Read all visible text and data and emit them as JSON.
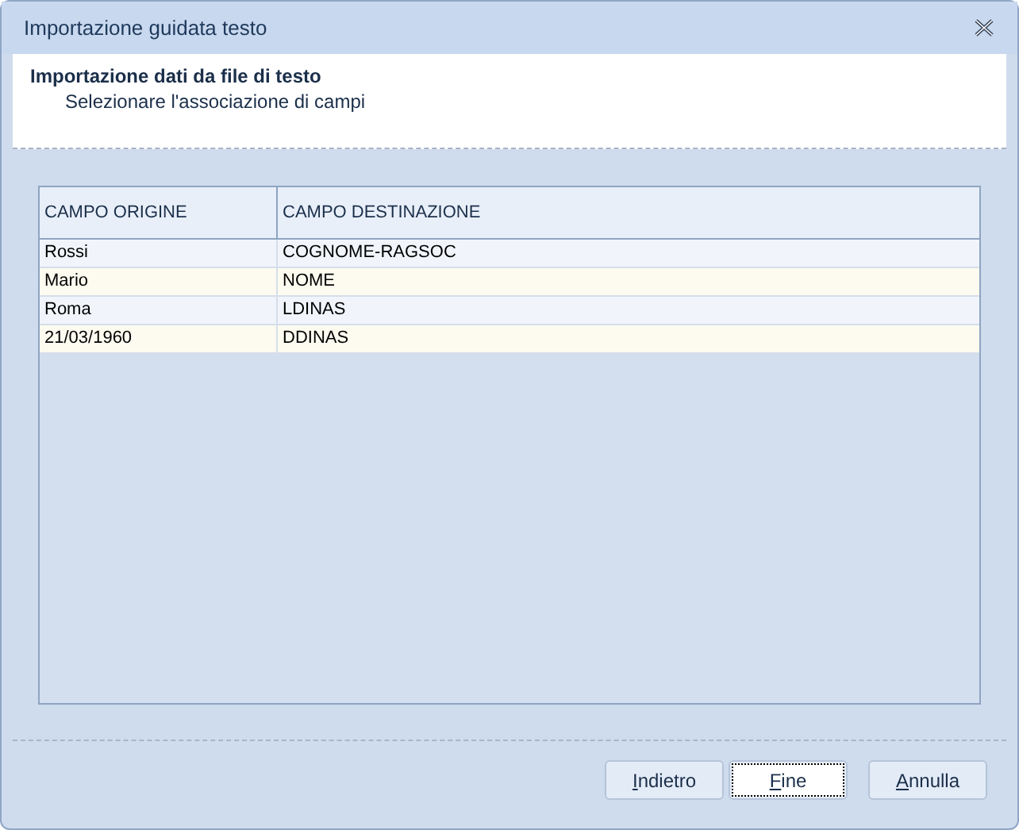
{
  "window": {
    "title": "Importazione guidata testo"
  },
  "header": {
    "title": "Importazione dati da file di testo",
    "subtitle": "Selezionare l'associazione di campi"
  },
  "table": {
    "columns": [
      "CAMPO ORIGINE",
      "CAMPO DESTINAZIONE"
    ],
    "rows": [
      {
        "cells": [
          "Rossi",
          "COGNOME-RAGSOC"
        ]
      },
      {
        "cells": [
          "Mario",
          "NOME"
        ]
      },
      {
        "cells": [
          "Roma",
          "LDINAS"
        ]
      },
      {
        "cells": [
          "21/03/1960",
          "DDINAS"
        ]
      }
    ]
  },
  "buttons": [
    {
      "label": "Indietro",
      "access_key_underlined": true,
      "focused": false
    },
    {
      "label": "Fine",
      "access_key_underlined": true,
      "focused": true
    },
    {
      "label": "Annulla",
      "access_key_underlined": true,
      "focused": false
    }
  ]
}
